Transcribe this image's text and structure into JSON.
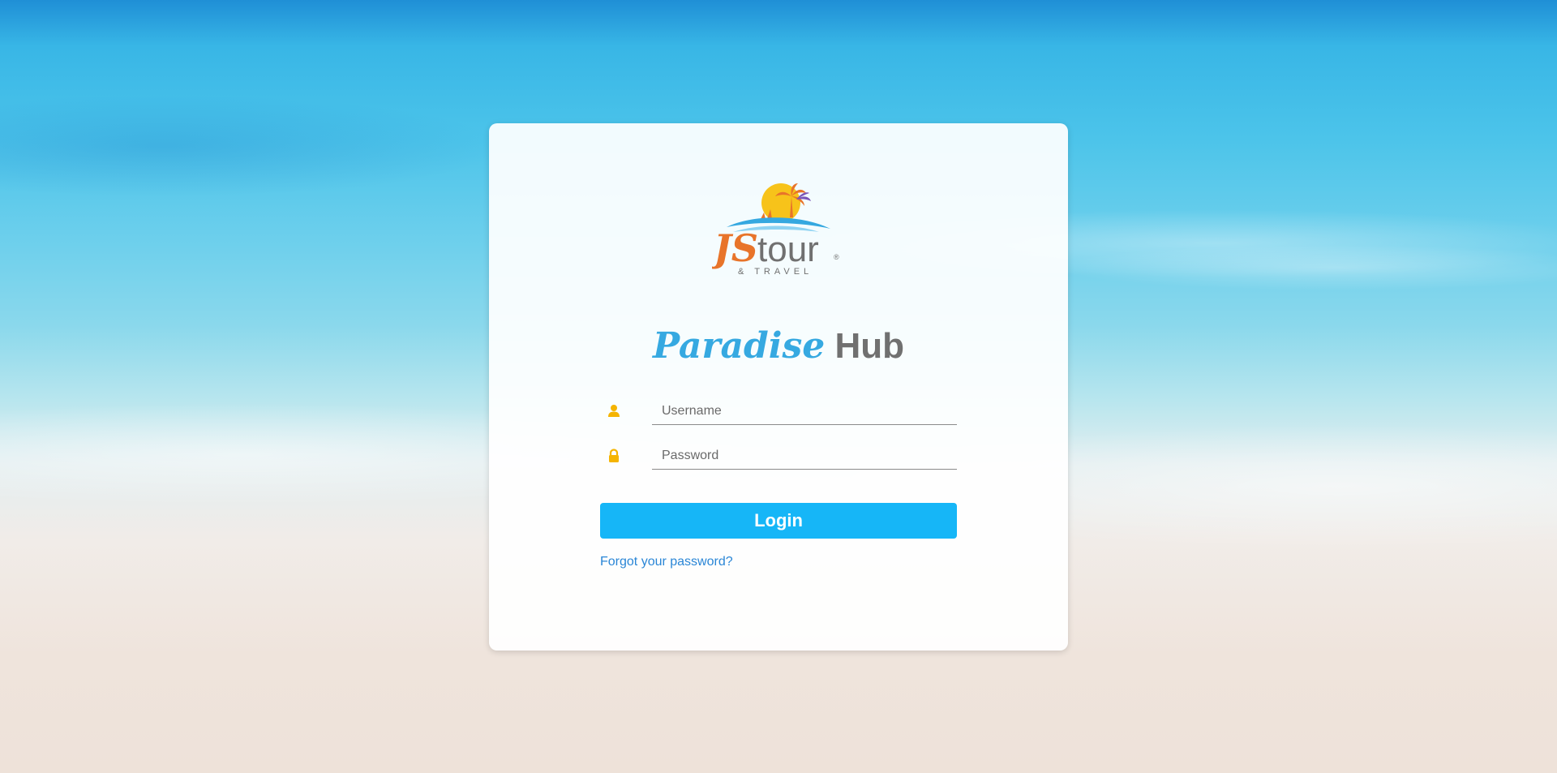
{
  "logo": {
    "brand_main": "JS",
    "brand_second": "tour",
    "tagline": "& TRAVEL",
    "registered_mark": "®"
  },
  "title": {
    "word1": "Paradise",
    "word2": "Hub"
  },
  "form": {
    "username_placeholder": "Username",
    "username_value": "",
    "password_placeholder": "Password",
    "password_value": "",
    "login_label": "Login",
    "forgot_label": "Forgot your password?"
  },
  "colors": {
    "accent": "#16b6f7",
    "title_blue": "#36a9e1",
    "title_gray": "#707070",
    "icon_amber": "#f5b400",
    "link": "#2a86d6"
  },
  "icons": {
    "username": "user-icon",
    "password": "lock-icon"
  }
}
